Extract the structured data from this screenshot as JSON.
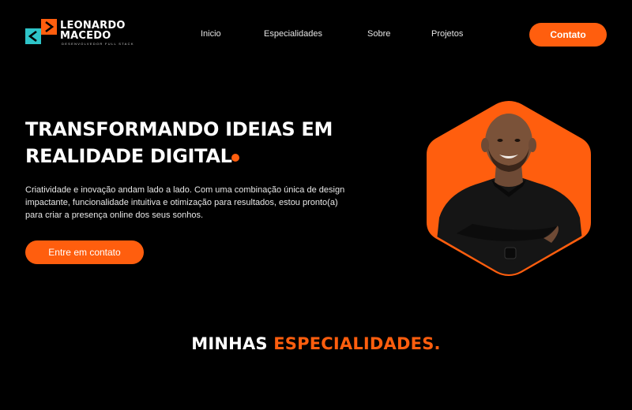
{
  "brand": {
    "name_line1": "LEONARDO",
    "name_line2": "MACEDO",
    "tagline": "DESENVOLVEDOR FULL STACK",
    "icon": "code-brackets-icon",
    "colors": {
      "accent": "#ff5e0e",
      "teal": "#2ec4c8"
    }
  },
  "nav": {
    "items": [
      {
        "label": "Inicio"
      },
      {
        "label": "Especialidades"
      },
      {
        "label": "Sobre"
      },
      {
        "label": "Projetos"
      }
    ],
    "contact_label": "Contato"
  },
  "hero": {
    "title_line1": "TRANSFORMANDO IDEIAS EM",
    "title_line2": "REALIDADE DIGITAL",
    "description": "Criatividade e inovação andam lado a lado. Com uma combinação única de design impactante, funcionalidade intuitiva e otimização para resultados, estou pronto(a) para criar a presença online dos seus sonhos.",
    "cta_label": "Entre em contato"
  },
  "section": {
    "title_part1": "MINHAS ",
    "title_part2": "ESPECIALIDADES."
  }
}
